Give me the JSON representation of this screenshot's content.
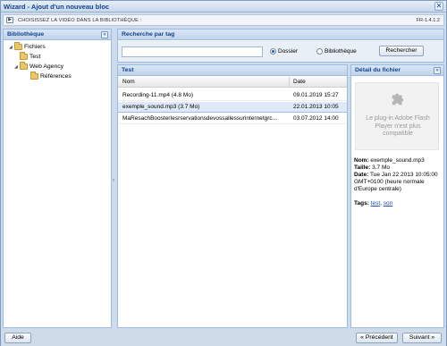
{
  "window": {
    "title": "Wizard - Ajout d'un nouveau bloc",
    "close_glyph": "✕"
  },
  "infobar": {
    "icon": "film-icon",
    "text": "CHOISISSEZ LA VIDÉO DANS LA BIBLIOTHÈQUE :",
    "version": "FR-1.4.1.2"
  },
  "library": {
    "title": "Bibliothèque",
    "tree": [
      {
        "label": "Fichiers"
      },
      {
        "label": "Test"
      },
      {
        "label": "Web Agency"
      },
      {
        "label": "Références"
      }
    ]
  },
  "search": {
    "title": "Recherche par tag",
    "value": "",
    "radio_folder": "Dossier",
    "radio_library": "Bibliothèque",
    "selected": "Dossier",
    "button": "Rechercher"
  },
  "results": {
    "title": "Test",
    "columns": [
      "Nom",
      "Date"
    ],
    "rows": [
      {
        "name": "Recording-11.mp4 (4.8 Mo)",
        "date": "09.01.2019 15:27"
      },
      {
        "name": "exemple_sound.mp3 (3.7 Mo)",
        "date": "22.01.2013 10:05"
      },
      {
        "name": "MaResachBoosterIesrservationsdevossallessurinternetgrc...",
        "date": "03.07.2012 14:00"
      }
    ],
    "selected_row": 1
  },
  "detail": {
    "title": "Détail du fichier",
    "plugin_message": "Le plug-in Adobe Flash Player n'est plus compatible",
    "name_label": "Nom:",
    "name_value": "exemple_sound.mp3",
    "size_label": "Taille:",
    "size_value": "3.7 Mo",
    "date_label": "Date:",
    "date_value": "Tue Jan 22 2013 10:05:00 GMT+0100 (heure normale d'Europe centrale)",
    "tags_label": "Tags:",
    "tags": [
      "test",
      "son"
    ]
  },
  "footer": {
    "help": "Aide",
    "prev": "« Précédent",
    "next": "Suivant »"
  }
}
